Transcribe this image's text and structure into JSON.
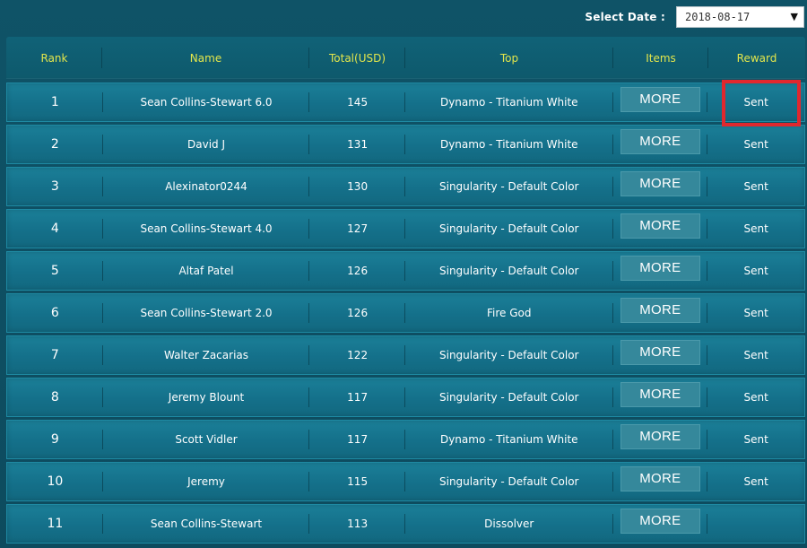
{
  "filter": {
    "label": "Select Date :",
    "selected_date": "2018-08-17"
  },
  "table": {
    "headers": {
      "rank": "Rank",
      "name": "Name",
      "total": "Total(USD)",
      "top": "Top",
      "items": "Items",
      "reward": "Reward"
    },
    "rows": [
      {
        "rank": "1",
        "name": "Sean Collins-Stewart 6.0",
        "total": "145",
        "top": "Dynamo - Titanium White",
        "items": "MORE",
        "reward": "Sent"
      },
      {
        "rank": "2",
        "name": "David J",
        "total": "131",
        "top": "Dynamo - Titanium White",
        "items": "MORE",
        "reward": "Sent"
      },
      {
        "rank": "3",
        "name": "Alexinator0244",
        "total": "130",
        "top": "Singularity - Default Color",
        "items": "MORE",
        "reward": "Sent"
      },
      {
        "rank": "4",
        "name": "Sean Collins-Stewart 4.0",
        "total": "127",
        "top": "Singularity - Default Color",
        "items": "MORE",
        "reward": "Sent"
      },
      {
        "rank": "5",
        "name": "Altaf Patel",
        "total": "126",
        "top": "Singularity - Default Color",
        "items": "MORE",
        "reward": "Sent"
      },
      {
        "rank": "6",
        "name": "Sean Collins-Stewart 2.0",
        "total": "126",
        "top": "Fire God",
        "items": "MORE",
        "reward": "Sent"
      },
      {
        "rank": "7",
        "name": "Walter Zacarias",
        "total": "122",
        "top": "Singularity - Default Color",
        "items": "MORE",
        "reward": "Sent"
      },
      {
        "rank": "8",
        "name": "Jeremy Blount",
        "total": "117",
        "top": "Singularity - Default Color",
        "items": "MORE",
        "reward": "Sent"
      },
      {
        "rank": "9",
        "name": "Scott Vidler",
        "total": "117",
        "top": "Dynamo - Titanium White",
        "items": "MORE",
        "reward": "Sent"
      },
      {
        "rank": "10",
        "name": "Jeremy",
        "total": "115",
        "top": "Singularity - Default Color",
        "items": "MORE",
        "reward": "Sent"
      },
      {
        "rank": "11",
        "name": "Sean Collins-Stewart",
        "total": "113",
        "top": "Dissolver",
        "items": "MORE",
        "reward": ""
      }
    ]
  },
  "colors": {
    "background": "#0e5064",
    "header_text": "#e3e64b",
    "row_bg": "#14708a",
    "button_bg": "#35889b",
    "highlight": "#e0282e"
  },
  "icons": {
    "dropdown": "caret-down-icon"
  }
}
